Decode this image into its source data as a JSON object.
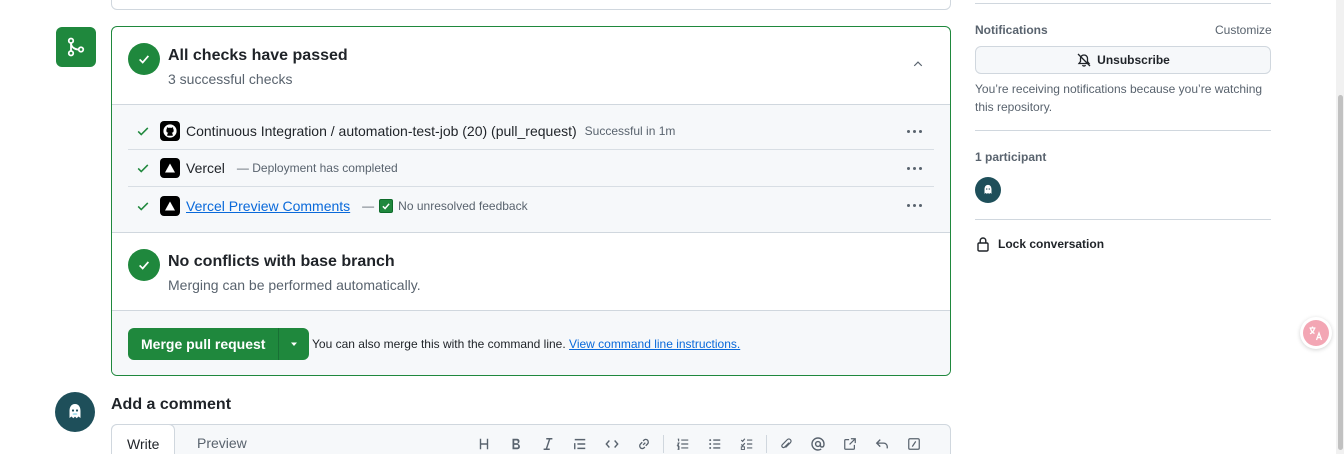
{
  "checks_section": {
    "title": "All checks have passed",
    "subtitle": "3 successful checks",
    "checks": [
      {
        "app": "GitHub Actions",
        "icon": "github-icon",
        "name": "Continuous Integration / automation-test-job (20) (pull_request)",
        "desc": "Successful in 1m",
        "is_link": false
      },
      {
        "app": "Vercel",
        "icon": "vercel-icon",
        "name": "Vercel",
        "desc": "— Deployment has completed",
        "is_link": false
      },
      {
        "app": "Vercel",
        "icon": "vercel-icon",
        "name": "Vercel Preview Comments",
        "desc_prefix": "—",
        "desc": "No unresolved feedback",
        "is_link": true
      }
    ]
  },
  "conflicts_section": {
    "title": "No conflicts with base branch",
    "subtitle": "Merging can be performed automatically."
  },
  "merge": {
    "button_label": "Merge pull request",
    "hint_text": "You can also merge this with the command line.",
    "hint_link": "View command line instructions."
  },
  "comment": {
    "title": "Add a comment",
    "tabs": [
      "Write",
      "Preview"
    ],
    "toolbar_icons": [
      "heading-icon",
      "bold-icon",
      "italic-icon",
      "quote-icon",
      "code-icon",
      "link-icon",
      "ordered-list-icon",
      "unordered-list-icon",
      "task-list-icon",
      "attach-icon",
      "mention-icon",
      "cross-reference-icon",
      "reply-icon",
      "slash-command-icon"
    ]
  },
  "sidebar": {
    "notifications_heading": "Notifications",
    "customize_label": "Customize",
    "unsubscribe_label": "Unsubscribe",
    "notifications_text": "You’re receiving notifications because you’re watching this repository.",
    "participants_heading": "1 participant",
    "lock_label": "Lock conversation"
  },
  "colors": {
    "success_green": "#1f883d",
    "link_blue": "#0969da",
    "border": "#d0d7de",
    "muted_text": "#59636e",
    "subtle_bg": "#f6f8fa"
  }
}
